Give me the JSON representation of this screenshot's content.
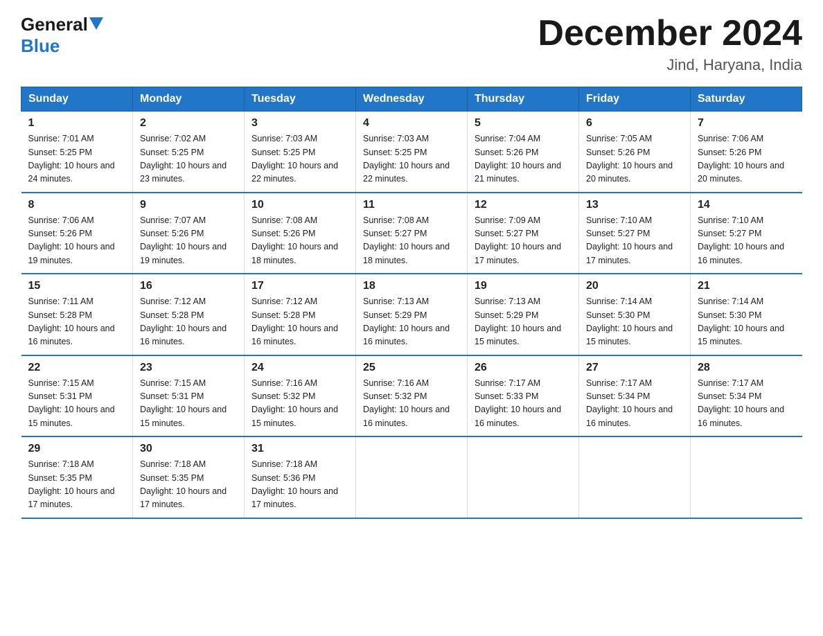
{
  "header": {
    "logo_general": "General",
    "logo_blue": "Blue",
    "month_title": "December 2024",
    "location": "Jind, Haryana, India"
  },
  "days_of_week": [
    "Sunday",
    "Monday",
    "Tuesday",
    "Wednesday",
    "Thursday",
    "Friday",
    "Saturday"
  ],
  "weeks": [
    [
      {
        "num": "1",
        "sunrise": "7:01 AM",
        "sunset": "5:25 PM",
        "daylight": "10 hours and 24 minutes."
      },
      {
        "num": "2",
        "sunrise": "7:02 AM",
        "sunset": "5:25 PM",
        "daylight": "10 hours and 23 minutes."
      },
      {
        "num": "3",
        "sunrise": "7:03 AM",
        "sunset": "5:25 PM",
        "daylight": "10 hours and 22 minutes."
      },
      {
        "num": "4",
        "sunrise": "7:03 AM",
        "sunset": "5:25 PM",
        "daylight": "10 hours and 22 minutes."
      },
      {
        "num": "5",
        "sunrise": "7:04 AM",
        "sunset": "5:26 PM",
        "daylight": "10 hours and 21 minutes."
      },
      {
        "num": "6",
        "sunrise": "7:05 AM",
        "sunset": "5:26 PM",
        "daylight": "10 hours and 20 minutes."
      },
      {
        "num": "7",
        "sunrise": "7:06 AM",
        "sunset": "5:26 PM",
        "daylight": "10 hours and 20 minutes."
      }
    ],
    [
      {
        "num": "8",
        "sunrise": "7:06 AM",
        "sunset": "5:26 PM",
        "daylight": "10 hours and 19 minutes."
      },
      {
        "num": "9",
        "sunrise": "7:07 AM",
        "sunset": "5:26 PM",
        "daylight": "10 hours and 19 minutes."
      },
      {
        "num": "10",
        "sunrise": "7:08 AM",
        "sunset": "5:26 PM",
        "daylight": "10 hours and 18 minutes."
      },
      {
        "num": "11",
        "sunrise": "7:08 AM",
        "sunset": "5:27 PM",
        "daylight": "10 hours and 18 minutes."
      },
      {
        "num": "12",
        "sunrise": "7:09 AM",
        "sunset": "5:27 PM",
        "daylight": "10 hours and 17 minutes."
      },
      {
        "num": "13",
        "sunrise": "7:10 AM",
        "sunset": "5:27 PM",
        "daylight": "10 hours and 17 minutes."
      },
      {
        "num": "14",
        "sunrise": "7:10 AM",
        "sunset": "5:27 PM",
        "daylight": "10 hours and 16 minutes."
      }
    ],
    [
      {
        "num": "15",
        "sunrise": "7:11 AM",
        "sunset": "5:28 PM",
        "daylight": "10 hours and 16 minutes."
      },
      {
        "num": "16",
        "sunrise": "7:12 AM",
        "sunset": "5:28 PM",
        "daylight": "10 hours and 16 minutes."
      },
      {
        "num": "17",
        "sunrise": "7:12 AM",
        "sunset": "5:28 PM",
        "daylight": "10 hours and 16 minutes."
      },
      {
        "num": "18",
        "sunrise": "7:13 AM",
        "sunset": "5:29 PM",
        "daylight": "10 hours and 16 minutes."
      },
      {
        "num": "19",
        "sunrise": "7:13 AM",
        "sunset": "5:29 PM",
        "daylight": "10 hours and 15 minutes."
      },
      {
        "num": "20",
        "sunrise": "7:14 AM",
        "sunset": "5:30 PM",
        "daylight": "10 hours and 15 minutes."
      },
      {
        "num": "21",
        "sunrise": "7:14 AM",
        "sunset": "5:30 PM",
        "daylight": "10 hours and 15 minutes."
      }
    ],
    [
      {
        "num": "22",
        "sunrise": "7:15 AM",
        "sunset": "5:31 PM",
        "daylight": "10 hours and 15 minutes."
      },
      {
        "num": "23",
        "sunrise": "7:15 AM",
        "sunset": "5:31 PM",
        "daylight": "10 hours and 15 minutes."
      },
      {
        "num": "24",
        "sunrise": "7:16 AM",
        "sunset": "5:32 PM",
        "daylight": "10 hours and 15 minutes."
      },
      {
        "num": "25",
        "sunrise": "7:16 AM",
        "sunset": "5:32 PM",
        "daylight": "10 hours and 16 minutes."
      },
      {
        "num": "26",
        "sunrise": "7:17 AM",
        "sunset": "5:33 PM",
        "daylight": "10 hours and 16 minutes."
      },
      {
        "num": "27",
        "sunrise": "7:17 AM",
        "sunset": "5:34 PM",
        "daylight": "10 hours and 16 minutes."
      },
      {
        "num": "28",
        "sunrise": "7:17 AM",
        "sunset": "5:34 PM",
        "daylight": "10 hours and 16 minutes."
      }
    ],
    [
      {
        "num": "29",
        "sunrise": "7:18 AM",
        "sunset": "5:35 PM",
        "daylight": "10 hours and 17 minutes."
      },
      {
        "num": "30",
        "sunrise": "7:18 AM",
        "sunset": "5:35 PM",
        "daylight": "10 hours and 17 minutes."
      },
      {
        "num": "31",
        "sunrise": "7:18 AM",
        "sunset": "5:36 PM",
        "daylight": "10 hours and 17 minutes."
      },
      null,
      null,
      null,
      null
    ]
  ]
}
